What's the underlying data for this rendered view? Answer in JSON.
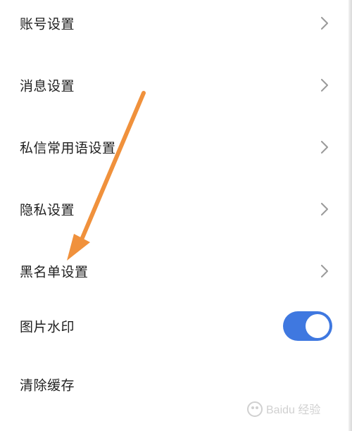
{
  "settings": {
    "items": [
      {
        "label": "账号设置",
        "type": "link"
      },
      {
        "label": "消息设置",
        "type": "link"
      },
      {
        "label": "私信常用语设置",
        "type": "link"
      },
      {
        "label": "隐私设置",
        "type": "link"
      },
      {
        "label": "黑名单设置",
        "type": "link"
      },
      {
        "label": "图片水印",
        "type": "toggle",
        "enabled": true
      },
      {
        "label": "清除缓存",
        "type": "link"
      }
    ]
  },
  "icons": {
    "chevron": "chevron-right-icon",
    "annotation": "orange-arrow-annotation",
    "watermark": "baidu-jingyan-logo"
  },
  "colors": {
    "toggle_on": "#3f78e0",
    "annotation_arrow": "#f0913c",
    "chevron": "#9a9a9a"
  },
  "watermark": {
    "text": "Baidu 经验"
  }
}
